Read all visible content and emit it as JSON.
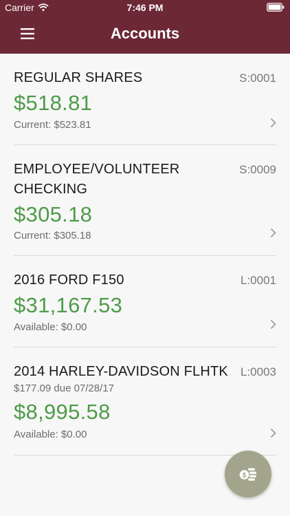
{
  "status": {
    "carrier": "Carrier",
    "time": "7:46 PM"
  },
  "header": {
    "title": "Accounts"
  },
  "accounts": [
    {
      "name": "REGULAR SHARES",
      "code": "S:0001",
      "balance": "$518.81",
      "detail": "Current: $523.81"
    },
    {
      "name_line1": "EMPLOYEE/VOLUNTEER",
      "name_line2": "CHECKING",
      "code": "S:0009",
      "balance": "$305.18",
      "detail": "Current: $305.18"
    },
    {
      "name": "2016 FORD F150",
      "code": "L:0001",
      "balance": "$31,167.53",
      "detail": "Available: $0.00"
    },
    {
      "name": "2014 HARLEY-DAVIDSON FLHTK",
      "code": "L:0003",
      "due": "$177.09 due 07/28/17",
      "balance": "$8,995.58",
      "detail": "Available: $0.00"
    }
  ],
  "colors": {
    "brand": "#6d2836",
    "balance_green": "#4e9b48",
    "fab": "#a2a58b"
  },
  "icons": {
    "menu": "hamburger-menu-icon",
    "row": "chevron-right-icon",
    "fab": "dollar-coins-icon",
    "wifi": "wifi-icon",
    "battery": "battery-icon"
  }
}
